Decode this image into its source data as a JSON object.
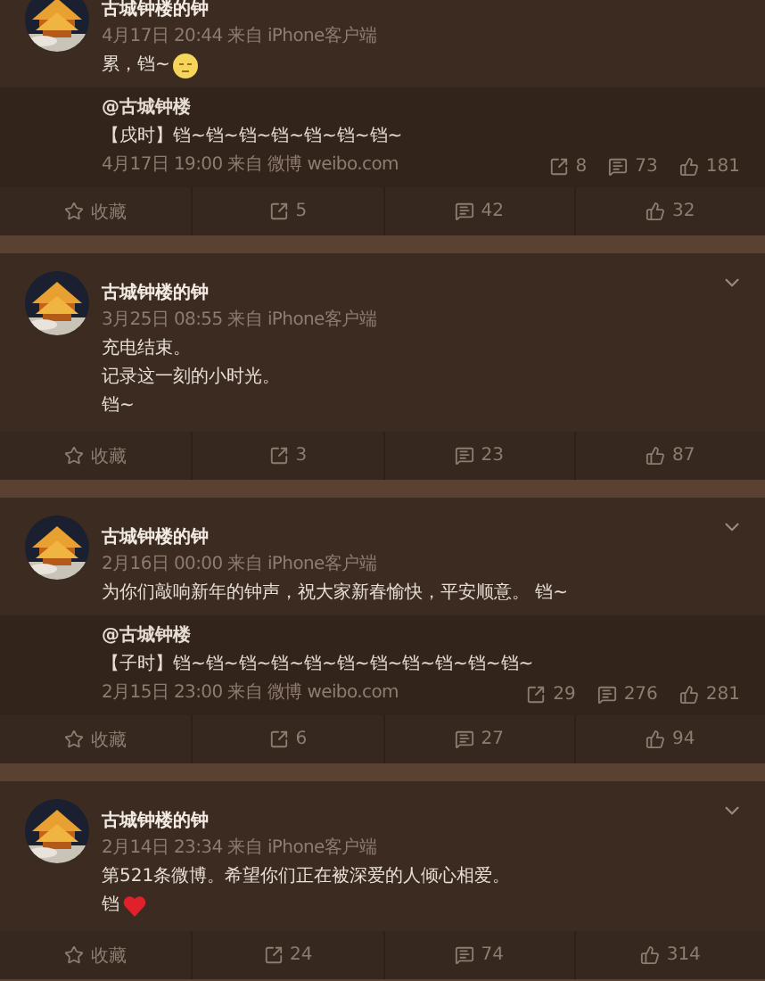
{
  "posts": [
    {
      "author": "古城钟楼的钟",
      "meta": "4月17日 20:44 来自 iPhone客户端",
      "menu": false,
      "lines": [
        "累，铛~"
      ],
      "trailing_icon": {
        "kind": "face"
      },
      "repost": {
        "author": "@古城钟楼",
        "text": "【戌时】铛~铛~铛~铛~铛~铛~铛~",
        "meta": "4月17日 19:00 来自 微博 weibo.com",
        "reposts": "8",
        "comments": "73",
        "likes": "181"
      },
      "actions": {
        "favorite": "收藏",
        "reposts": "5",
        "comments": "42",
        "likes": "32"
      }
    },
    {
      "author": "古城钟楼的钟",
      "meta": "3月25日 08:55 来自 iPhone客户端",
      "menu": true,
      "lines": [
        "充电结束。",
        "记录这一刻的小时光。",
        "铛~"
      ],
      "actions": {
        "favorite": "收藏",
        "reposts": "3",
        "comments": "23",
        "likes": "87"
      }
    },
    {
      "author": "古城钟楼的钟",
      "meta": "2月16日 00:00 来自 iPhone客户端",
      "menu": true,
      "lines": [
        "为你们敲响新年的钟声，祝大家新春愉快，平安顺意。 铛~"
      ],
      "repost": {
        "author": "@古城钟楼",
        "text": "【子时】铛~铛~铛~铛~铛~铛~铛~铛~铛~铛~铛~",
        "meta": "2月15日 23:00 来自 微博 weibo.com",
        "reposts": "29",
        "comments": "276",
        "likes": "281"
      },
      "actions": {
        "favorite": "收藏",
        "reposts": "6",
        "comments": "27",
        "likes": "94"
      }
    },
    {
      "author": "古城钟楼的钟",
      "meta": "2月14日 23:34 来自 iPhone客户端",
      "menu": true,
      "lines": [
        "第521条微博。希望你们正在被深爱的人倾心相爱。",
        "铛"
      ],
      "trailing_icon": {
        "kind": "heart"
      },
      "actions": {
        "favorite": "收藏",
        "reposts": "24",
        "comments": "74",
        "likes": "314"
      }
    }
  ]
}
